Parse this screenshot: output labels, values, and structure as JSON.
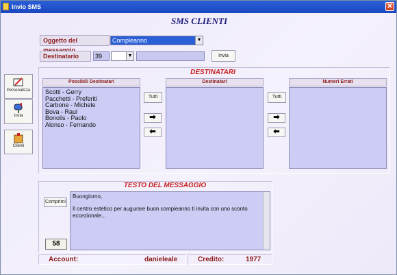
{
  "window": {
    "title": "Invio SMS"
  },
  "heading": "SMS CLIENTI",
  "oggetto": {
    "label": "Oggetto del messaggio",
    "value": "Compleanno"
  },
  "destinatario": {
    "label": "Destinatario",
    "code": "39",
    "prefix": "",
    "number": ""
  },
  "buttons": {
    "invia_top": "Invia",
    "tutti1": "Tutti",
    "tutti2": "Tutti",
    "comprimi": "Comprimi"
  },
  "sidebar": [
    {
      "label": "Personalizza",
      "icon": "personalizza-icon"
    },
    {
      "label": "Invia",
      "icon": "mailbox-icon"
    },
    {
      "label": "Clienti",
      "icon": "clients-icon"
    }
  ],
  "destinatari": {
    "title": "DESTINATARI",
    "possibili_header": "Possibili Destinatari",
    "destinatari_header": "Destinatari",
    "errati_header": "Numeri Errati",
    "possibili": [
      "Scotti - Gerry",
      "Pacchetti - Preferiti",
      "Carbone - Michele",
      "Bova - Raul",
      "Bonolis - Paolo",
      "Alonso - Fernando"
    ]
  },
  "arrows": {
    "right": "➡",
    "left": "⬅"
  },
  "testo": {
    "title": "TESTO DEL MESSAGGIO",
    "line1": "Buongiorno,",
    "line2": "Il centro estetico per augurare buon compleanno ti invita con uno sconto eccezionale...",
    "count": "58"
  },
  "status": {
    "account_label": "Account:",
    "account_value": "danieleale",
    "credito_label": "Credito:",
    "credito_value": "1977"
  }
}
